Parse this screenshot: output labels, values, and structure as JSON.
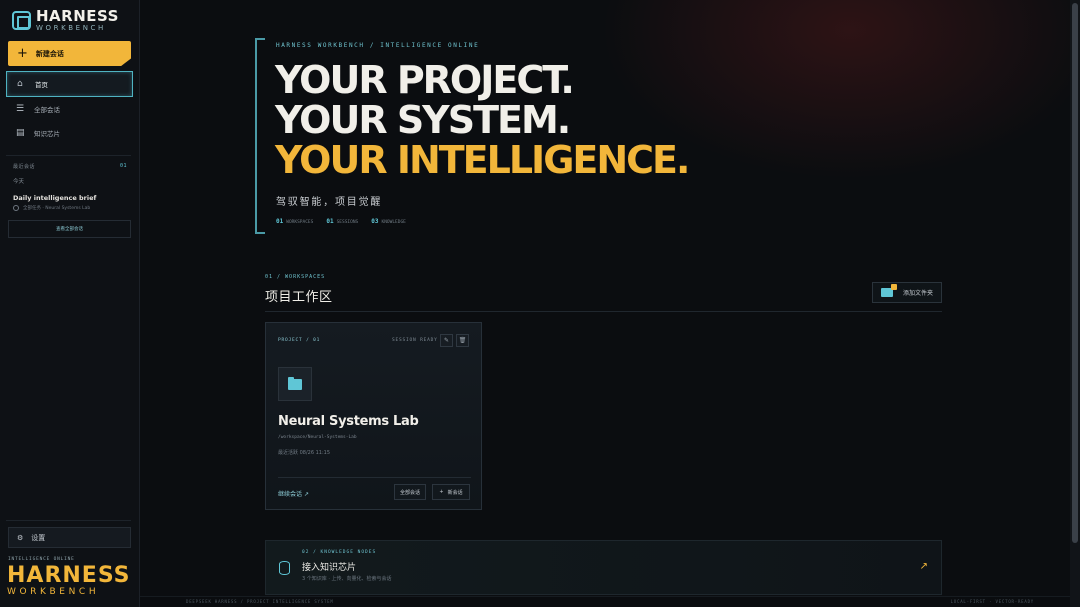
{
  "sidebar": {
    "logo_title": "HARNESS",
    "logo_sub": "WORKBENCH",
    "new_chat": "新建会话",
    "nav": [
      {
        "label": "首页",
        "icon": "home-icon"
      },
      {
        "label": "全部会话",
        "icon": "list-icon"
      },
      {
        "label": "知识芯片",
        "icon": "chip-icon"
      }
    ],
    "recent_label": "最近会话",
    "recent_count": "01",
    "today": "今天",
    "brief_title": "Daily intelligence brief",
    "brief_sub": "全部任务 · Neural Systems Lab",
    "view_all": "查看全部会话",
    "settings": "设置",
    "intel_online": "INTELLIGENCE ONLINE",
    "big_logo_1": "HARNESS",
    "big_logo_2": "WORKBENCH"
  },
  "hero": {
    "eyebrow": "HARNESS WORKBENCH / INTELLIGENCE ONLINE",
    "line1": "YOUR PROJECT.",
    "line2": "YOUR SYSTEM.",
    "line3": "YOUR INTELLIGENCE.",
    "subtitle": "驾驭智能，项目觉醒",
    "stats": [
      {
        "num": "01",
        "label": "WORKSPACES"
      },
      {
        "num": "01",
        "label": "SESSIONS"
      },
      {
        "num": "03",
        "label": "KNOWLEDGE"
      }
    ]
  },
  "workspaces": {
    "eyebrow": "01 / WORKSPACES",
    "title": "项目工作区",
    "add_folder": "添加文件夹",
    "card": {
      "tag": "PROJECT / 01",
      "status": "SESSION READY",
      "name": "Neural Systems Lab",
      "path": "/workspace/Neural-Systems-Lab",
      "last_active": "最近活跃 08/26 11:15",
      "continue": "继续会话",
      "all_sessions": "全部会话",
      "new_chat": "新会话"
    }
  },
  "knowledge": {
    "eyebrow": "02 / KNOWLEDGE NODES",
    "title": "接入知识芯片",
    "subtitle": "3 个知识库 · 上传、向量化、检索与会话"
  },
  "footer": {
    "left": "DEEPSEEK HARNESS / PROJECT INTELLIGENCE SYSTEM",
    "right": "LOCAL-FIRST · VECTOR-READY"
  },
  "colors": {
    "accent": "#f2b63a",
    "cyan": "#5fc6d6",
    "background": "#0b0d10"
  }
}
